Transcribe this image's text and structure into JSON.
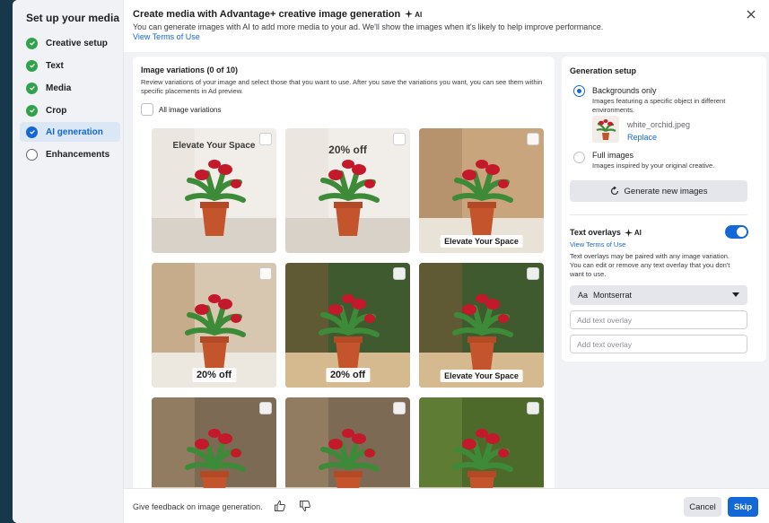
{
  "sidebar": {
    "title": "Set up your media",
    "steps": [
      {
        "label": "Creative setup",
        "state": "done"
      },
      {
        "label": "Text",
        "state": "done"
      },
      {
        "label": "Media",
        "state": "done"
      },
      {
        "label": "Crop",
        "state": "done"
      },
      {
        "label": "AI generation",
        "state": "current"
      },
      {
        "label": "Enhancements",
        "state": "pending"
      }
    ]
  },
  "header": {
    "title": "Create media with Advantage+ creative image generation",
    "ai_badge": "AI",
    "description": "You can generate images with AI to add more media to your ad. We'll show the images when it's likely to help improve performance.",
    "terms_link": "View Terms of Use"
  },
  "variations": {
    "title": "Image variations (0 of 10)",
    "description": "Review variations of your image and select those that you want to use. After you save the variations you want, you can see them within specific placements in Ad preview.",
    "all_label": "All image variations",
    "tiles": [
      {
        "overlay": "Elevate Your Space",
        "bg": "studio"
      },
      {
        "overlay": "20% off",
        "bg": "studio"
      },
      {
        "overlay": "Elevate Your Space",
        "bg": "kitchen"
      },
      {
        "overlay": "20% off",
        "bg": "kitchen2"
      },
      {
        "overlay": "20% off",
        "bg": "window"
      },
      {
        "overlay": "Elevate Your Space",
        "bg": "window"
      },
      {
        "overlay": "",
        "bg": "kitchen3"
      },
      {
        "overlay": "",
        "bg": "kitchen3"
      },
      {
        "overlay": "",
        "bg": "green"
      }
    ]
  },
  "setup": {
    "title": "Generation setup",
    "option1_title": "Backgrounds only",
    "option1_desc": "Images featuring a specific object in different environments.",
    "file_name": "white_orchid.jpeg",
    "replace_label": "Replace",
    "option2_title": "Full images",
    "option2_desc": "Images inspired by your original creative.",
    "generate_label": "Generate new images"
  },
  "text_overlays": {
    "title": "Text overlays",
    "ai_badge": "AI",
    "terms_link": "View Terms of Use",
    "description": "Text overlays may be paired with any image variation. You can edit or remove any text overlay that you don't want to use.",
    "font_aa": "Aa",
    "font_value": "Montserrat",
    "input1_placeholder": "Add text overlay",
    "input2_placeholder": "Add text overlay",
    "toggle_on": true
  },
  "footer": {
    "feedback_text": "Give feedback on image generation.",
    "cancel_label": "Cancel",
    "skip_label": "Skip"
  },
  "colors": {
    "accent": "#1467d6",
    "success": "#31a24c",
    "backdrop": "#1b3a4b"
  }
}
